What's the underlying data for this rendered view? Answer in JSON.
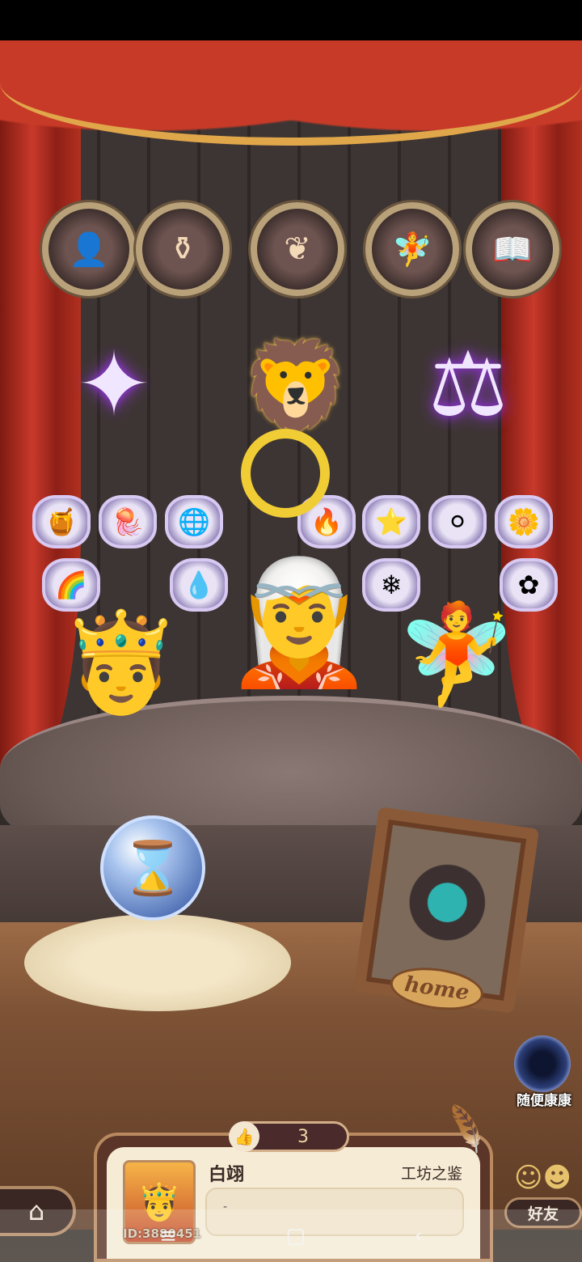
{
  "status_bar": {},
  "top_medallions": [
    {
      "icon": "silhouette-icon",
      "glyph": "👤"
    },
    {
      "icon": "cauldron-icon",
      "glyph": "⚱"
    },
    {
      "icon": "ornament-icon",
      "glyph": "❦"
    },
    {
      "icon": "fairy-icon",
      "glyph": "🧚"
    },
    {
      "icon": "book-icon",
      "glyph": "📖"
    }
  ],
  "emblems": [
    {
      "icon": "compass-star-icon",
      "glyph": "✦",
      "style": "purple"
    },
    {
      "icon": "lion-head-icon",
      "glyph": "🦁",
      "style": "teal"
    },
    {
      "icon": "lantern-scales-icon",
      "glyph": "⚖",
      "style": "purple"
    }
  ],
  "gems_row1": [
    {
      "icon": "honeycomb-icon",
      "glyph": "🍯"
    },
    {
      "icon": "jellyfish-icon",
      "glyph": "🪼"
    },
    {
      "icon": "planet-icon",
      "glyph": "🌐"
    },
    {
      "icon": "flame-icon",
      "glyph": "🔥"
    },
    {
      "icon": "star-icon",
      "glyph": "⭐"
    },
    {
      "icon": "pearl-icon",
      "glyph": "⚪"
    },
    {
      "icon": "yellow-flower-icon",
      "glyph": "🌼"
    }
  ],
  "gems_row2": [
    {
      "icon": "rainbow-icon",
      "glyph": "🌈"
    },
    {
      "icon": "slime-icon",
      "glyph": "💧"
    },
    {
      "icon": "crystal-icon",
      "glyph": "❄"
    },
    {
      "icon": "blue-flower-icon",
      "glyph": "✿"
    }
  ],
  "characters": [
    {
      "name": "hero-on-throne",
      "glyph": "🤴"
    },
    {
      "name": "silver-haired-doll",
      "glyph": "🧝"
    },
    {
      "name": "blue-haired-fairy",
      "glyph": "🧚"
    }
  ],
  "orb": {
    "icon": "hourglass-icon",
    "glyph": "⌛"
  },
  "frame": {
    "label": "home"
  },
  "portal": {
    "label": "随便康康"
  },
  "likes": {
    "icon": "thumb-up-icon",
    "glyph": "👍",
    "count": "3"
  },
  "card": {
    "avatar_glyph": "🤴",
    "player_id": "ID:3880451",
    "player_name": "白翊",
    "title": "工坊之鉴",
    "signature": "-"
  },
  "quill": {
    "glyph": "🪶"
  },
  "home_button": {
    "glyph": "⌂"
  },
  "friends": {
    "label": "好友",
    "glyph": "☺☻"
  },
  "navbar": {
    "menu": "≡",
    "home": "▢",
    "back": "‹"
  }
}
